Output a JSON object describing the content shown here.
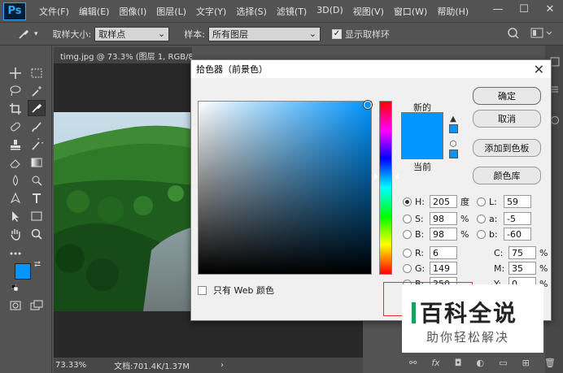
{
  "app": {
    "logo": "Ps",
    "menu": [
      "文件(F)",
      "编辑(E)",
      "图像(I)",
      "图层(L)",
      "文字(Y)",
      "选择(S)",
      "滤镜(T)",
      "3D(D)",
      "视图(V)",
      "窗口(W)",
      "帮助(H)"
    ],
    "window_buttons": [
      "—",
      "☐",
      "✕"
    ]
  },
  "options": {
    "sample_size_label": "取样大小:",
    "sample_size_value": "取样点",
    "sample_label": "样本:",
    "sample_value": "所有图层",
    "show_ring_label": "显示取样环"
  },
  "document": {
    "tab_title": "timg.jpg @ 73.3% (图层 1, RGB/8#) *",
    "zoom": "73.33%",
    "doc_info": "文档:701.4K/1.37M"
  },
  "dialog": {
    "title": "拾色器（前景色）",
    "new_label": "新的",
    "current_label": "当前",
    "buttons": {
      "ok": "确定",
      "cancel": "取消",
      "add_swatch": "添加到色板",
      "libraries": "颜色库"
    },
    "fields": {
      "H": {
        "label": "H:",
        "value": "205",
        "unit": "度"
      },
      "S": {
        "label": "S:",
        "value": "98",
        "unit": "%"
      },
      "B": {
        "label": "B:",
        "value": "98",
        "unit": "%"
      },
      "R": {
        "label": "R:",
        "value": "6"
      },
      "G": {
        "label": "G:",
        "value": "149"
      },
      "Bl": {
        "label": "B:",
        "value": "250"
      },
      "L": {
        "label": "L:",
        "value": "59"
      },
      "a": {
        "label": "a:",
        "value": "-5"
      },
      "b": {
        "label": "b:",
        "value": "-60"
      },
      "C": {
        "label": "C:",
        "value": "75",
        "unit": "%"
      },
      "M": {
        "label": "M:",
        "value": "35",
        "unit": "%"
      },
      "Y": {
        "label": "Y:",
        "value": "0",
        "unit": "%"
      }
    },
    "web_only_label": "只有 Web 颜色",
    "selected_color": "#0695fa"
  },
  "watermark": {
    "title": "百科全说",
    "subtitle": "助你轻松解决"
  },
  "colors": {
    "foreground": "#0095ff",
    "background": "#ffffff"
  }
}
